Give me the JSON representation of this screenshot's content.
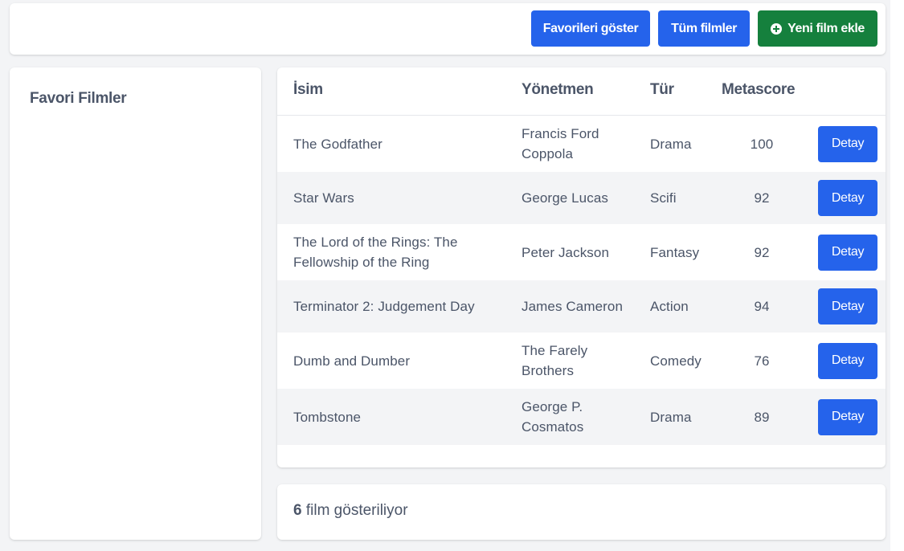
{
  "header": {
    "buttons": {
      "show_favorites": "Favorileri göster",
      "all_movies": "Tüm filmler",
      "add_movie": "Yeni film ekle"
    }
  },
  "sidebar": {
    "title": "Favori Filmler"
  },
  "table": {
    "columns": {
      "name": "İsim",
      "director": "Yönetmen",
      "genre": "Tür",
      "metascore": "Metascore"
    },
    "detail_label": "Detay",
    "rows": [
      {
        "name": [
          "The Godfather"
        ],
        "director": [
          "Francis Ford",
          "Coppola"
        ],
        "genre": "Drama",
        "metascore": "100"
      },
      {
        "name": [
          "Star Wars"
        ],
        "director": [
          "George Lucas"
        ],
        "genre": "Scifi",
        "metascore": "92"
      },
      {
        "name": [
          "The Lord of the Rings: The",
          "Fellowship of the Ring"
        ],
        "director": [
          "Peter Jackson"
        ],
        "genre": "Fantasy",
        "metascore": "92"
      },
      {
        "name": [
          "Terminator 2: Judgement Day"
        ],
        "director": [
          "James Cameron"
        ],
        "genre": "Action",
        "metascore": "94"
      },
      {
        "name": [
          "Dumb and Dumber"
        ],
        "director": [
          "The Farely",
          "Brothers"
        ],
        "genre": "Comedy",
        "metascore": "76"
      },
      {
        "name": [
          "Tombstone"
        ],
        "director": [
          "George P.",
          "Cosmatos"
        ],
        "genre": "Drama",
        "metascore": "89"
      }
    ]
  },
  "footer": {
    "count": "6",
    "suffix": " film gösteriliyor"
  },
  "colors": {
    "primary": "#2563eb",
    "success": "#15803d",
    "text": "#4b5568",
    "page_bg": "#f3f4f6"
  }
}
